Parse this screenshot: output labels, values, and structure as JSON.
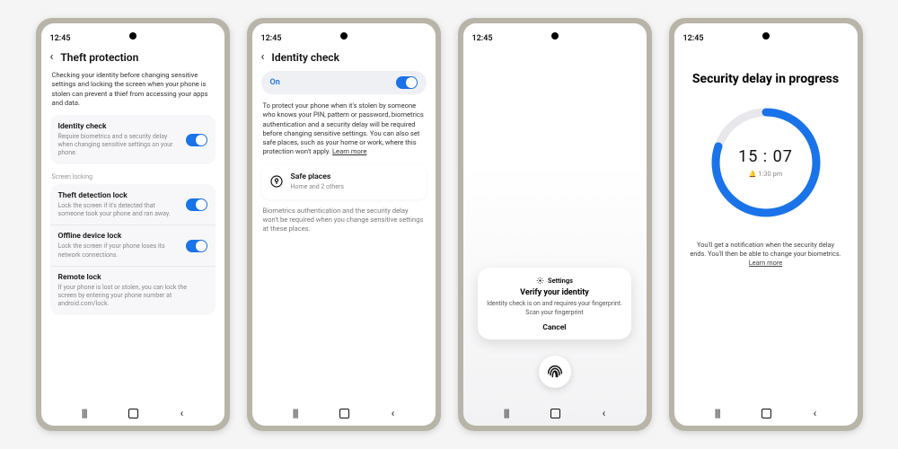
{
  "status_time": "12:45",
  "screen1": {
    "title": "Theft protection",
    "desc": "Checking your identity before changing sensitive settings and locking the screen when your phone is stolen can prevent a thief from accessing your apps and data.",
    "identity_check": {
      "title": "Identity check",
      "sub": "Require biometrics and a security delay when changing sensitive settings on your phone."
    },
    "section_label": "Screen locking",
    "theft_detection": {
      "title": "Theft detection lock",
      "sub": "Lock the screen if it's detected that someone took your phone and ran away."
    },
    "offline_lock": {
      "title": "Offline device lock",
      "sub": "Lock the screen if your phone loses its network connections."
    },
    "remote_lock": {
      "title": "Remote lock",
      "sub": "If your phone is lost or stolen, you can lock the screen by entering your phone number at android.com/lock."
    }
  },
  "screen2": {
    "title": "Identity check",
    "on_label": "On",
    "desc": "To protect your phone when it's stolen by someone who knows your PIN, pattern or password, biometrics authentication and a security delay will be required before changing sensitive settings. You can also set safe places, such as your home or work, where this protection won't apply.",
    "learn_more": "Learn more",
    "safe_places": {
      "title": "Safe places",
      "sub": "Home and 2 others"
    },
    "footnote": "Biometrics authentication and the security delay won't be required when you change sensitive settings at these places."
  },
  "screen3": {
    "settings_label": "Settings",
    "title": "Verify your identity",
    "body1": "Identity check is on and requires your fingerprint.",
    "body2": "Scan your fingerprint",
    "cancel": "Cancel"
  },
  "screen4": {
    "title": "Security delay in progress",
    "countdown": "15 : 07",
    "end_time": "1:30 pm",
    "body": "You'll get a notification when the security delay ends. You'll then be able to change your biometrics.",
    "learn_more": "Learn more"
  }
}
